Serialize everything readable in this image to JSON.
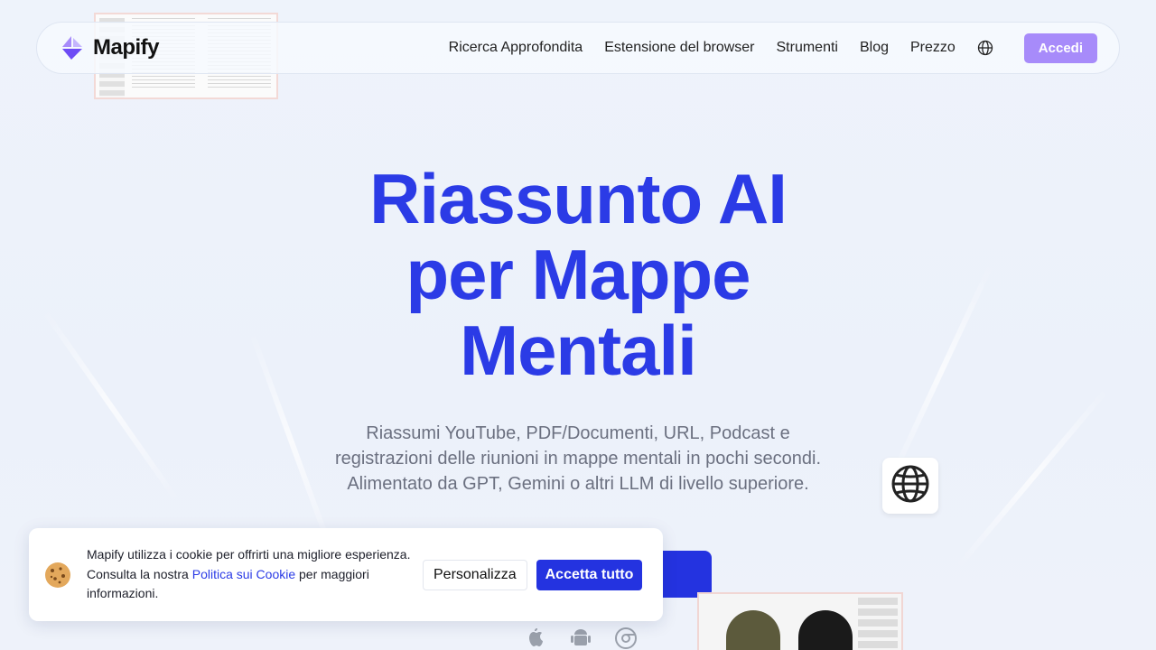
{
  "nav": {
    "brand": "Mapify",
    "links": [
      "Ricerca Approfondita",
      "Estensione del browser",
      "Strumenti",
      "Blog",
      "Prezzo"
    ],
    "login": "Accedi"
  },
  "hero": {
    "title_line1": "Riassunto AI",
    "title_line2": "per Mappe",
    "title_line3": "Mentali",
    "subtitle": "Riassumi YouTube, PDF/Documenti, URL, Podcast e registrazioni delle riunioni in mappe mentali in pochi secondi. Alimentato da GPT, Gemini o altri LLM di livello superiore."
  },
  "cookie": {
    "text_before": "Mapify utilizza i cookie per offrirti una migliore esperienza. Consulta la nostra ",
    "link": "Politica sui Cookie",
    "text_after": " per maggiori informazioni.",
    "customize": "Personalizza",
    "accept": "Accetta tutto"
  },
  "colors": {
    "accent": "#2b3be6",
    "login_bg": "#a78bfa"
  }
}
